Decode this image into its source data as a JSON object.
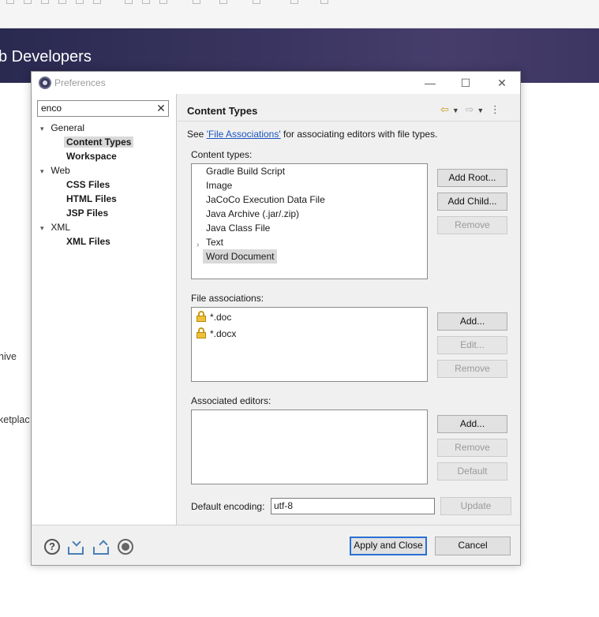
{
  "background": {
    "banner_title": "b Developers",
    "side_text_1": "hive",
    "side_text_2": "ketplac"
  },
  "dialog": {
    "title": "Preferences",
    "minimize_icon": "minimize-icon",
    "maximize_icon": "maximize-icon",
    "close_icon": "close-icon"
  },
  "filter": {
    "value": "enco",
    "clear_glyph": "✕"
  },
  "tree": {
    "general": {
      "label": "General",
      "children": [
        "Content Types",
        "Workspace"
      ]
    },
    "web": {
      "label": "Web",
      "children": [
        "CSS Files",
        "HTML Files",
        "JSP Files"
      ]
    },
    "xml": {
      "label": "XML",
      "children": [
        "XML Files"
      ]
    },
    "expanded_glyph": "▾"
  },
  "page": {
    "title": "Content Types",
    "see_prefix": "See ",
    "see_link": "'File Associations'",
    "see_suffix": " for associating editors with file types.",
    "content_types_label": "Content types:",
    "content_types": [
      "Gradle Build Script",
      "Image",
      "JaCoCo Execution Data File",
      "Java Archive (.jar/.zip)",
      "Java Class File",
      "Text",
      "Word Document"
    ],
    "content_types_selected": "Word Document",
    "file_assoc_label": "File associations:",
    "file_associations": [
      "*.doc",
      "*.docx"
    ],
    "assoc_editors_label": "Associated editors:",
    "encoding_label": "Default encoding:",
    "encoding_value": "utf-8"
  },
  "buttons": {
    "add_root": "Add Root...",
    "add_child": "Add Child...",
    "remove_ct": "Remove",
    "add_fa": "Add...",
    "edit_fa": "Edit...",
    "remove_fa": "Remove",
    "add_ed": "Add...",
    "remove_ed": "Remove",
    "default_ed": "Default",
    "update": "Update",
    "apply_close": "Apply and Close",
    "cancel": "Cancel"
  },
  "colors": {
    "link": "#1a53c0",
    "selection": "#d9d9d9",
    "banner": "#3a3560",
    "nav_arrow": "#c49b18"
  }
}
